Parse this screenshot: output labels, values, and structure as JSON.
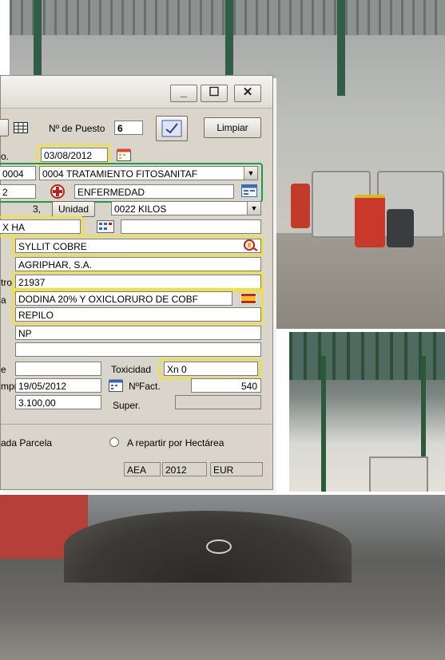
{
  "window": {
    "title": "",
    "minimize_glyph": "_",
    "maximize_glyph": "☐",
    "close_glyph": "✕"
  },
  "toolbar": {
    "puesto_label": "Nº de Puesto",
    "puesto_value": "6",
    "limpiar_label": "Limpiar"
  },
  "form": {
    "fecha_label_partial": "o.",
    "fecha_value": "03/08/2012",
    "tratamiento_code": "0004",
    "tratamiento_desc": "0004 TRATAMIENTO FITOSANITAF",
    "motivo_code": "2",
    "motivo_desc": "ENFERMEDAD",
    "cantidad_value": "3,",
    "unidad_label": "Unidad",
    "unidad_value": "0022 KILOS",
    "dosis_value": "X HA",
    "producto": "SYLLIT COBRE",
    "fabricante": "AGRIPHAR, S.A.",
    "registro_label_partial": "tro",
    "registro": "21937",
    "materia_label_partial": "a",
    "materia_activa": "DODINA 20% Y OXICLORURO DE COBF",
    "plaga": "REPILO",
    "plazo": "NP",
    "toxicidad_label": "Toxicidad",
    "toxicidad_value": "Xn  0",
    "compra_label_partial": "mpr",
    "compra_fecha": "19/05/2012",
    "factura_label": "NºFact.",
    "factura_value": "540",
    "importe": "3.100,00",
    "superficie_label": "Super.",
    "label_e_partial": "e"
  },
  "options": {
    "por_parcela": "ada Parcela",
    "por_hectarea": "A repartir por Hectárea"
  },
  "statusbar": {
    "s1": "AEA",
    "s2": "2012",
    "s3": "EUR"
  }
}
